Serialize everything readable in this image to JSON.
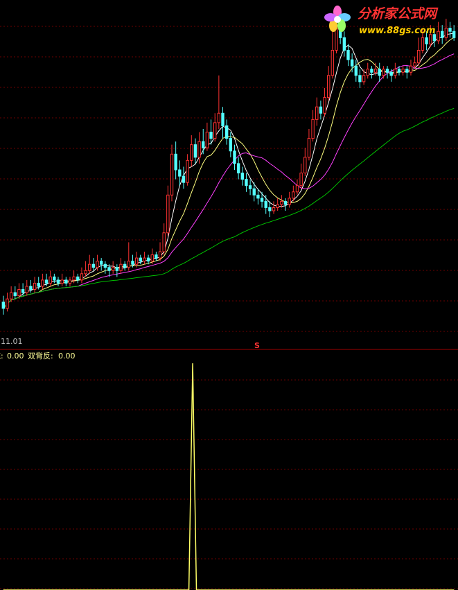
{
  "colors": {
    "background": "#000000",
    "grid": "#6b0000",
    "separator": "#a00000",
    "candle_up": "#ff3232",
    "candle_down": "#54ffff",
    "ma_short": "#ffffff",
    "ma_mid": "#ffff80",
    "ma_long": "#ff40ff",
    "ma_longest": "#00c000",
    "indicator_line": "#ffff66",
    "date_text": "#c0c0c0",
    "indicator_text": "#ffff99",
    "logo_text": "#ff3333",
    "url_text": "#ffcc00"
  },
  "header": {
    "date_label": "11.01",
    "marker": "S",
    "indicator_prefix": "底:",
    "indicator_prefix_value": "0.00",
    "indicator_name": "双背反:",
    "indicator_value": "0.00"
  },
  "logo": {
    "title": "分析家公式网",
    "url": "www.88gs.com",
    "icon": "flower-icon"
  },
  "chart_data": [
    {
      "type": "candlestick",
      "title": "",
      "xlabel": "",
      "ylabel": "",
      "grid": true,
      "ylim": [
        0,
        100
      ],
      "candles": [
        {
          "o": 8,
          "c": 6,
          "h": 10,
          "l": 4
        },
        {
          "o": 6,
          "c": 9,
          "h": 11,
          "l": 5
        },
        {
          "o": 9,
          "c": 11,
          "h": 13,
          "l": 8
        },
        {
          "o": 11,
          "c": 10,
          "h": 13,
          "l": 9
        },
        {
          "o": 10,
          "c": 12,
          "h": 14,
          "l": 9
        },
        {
          "o": 12,
          "c": 11,
          "h": 14,
          "l": 10
        },
        {
          "o": 11,
          "c": 13,
          "h": 15,
          "l": 10
        },
        {
          "o": 13,
          "c": 12,
          "h": 15,
          "l": 11
        },
        {
          "o": 12,
          "c": 14,
          "h": 16,
          "l": 11
        },
        {
          "o": 14,
          "c": 13,
          "h": 16,
          "l": 12
        },
        {
          "o": 13,
          "c": 15,
          "h": 17,
          "l": 12
        },
        {
          "o": 15,
          "c": 14,
          "h": 17,
          "l": 13
        },
        {
          "o": 14,
          "c": 16,
          "h": 18,
          "l": 13
        },
        {
          "o": 16,
          "c": 15,
          "h": 17,
          "l": 14
        },
        {
          "o": 15,
          "c": 14,
          "h": 16,
          "l": 13
        },
        {
          "o": 14,
          "c": 15,
          "h": 17,
          "l": 13
        },
        {
          "o": 15,
          "c": 14,
          "h": 16,
          "l": 13
        },
        {
          "o": 14,
          "c": 15,
          "h": 16,
          "l": 13
        },
        {
          "o": 15,
          "c": 16,
          "h": 18,
          "l": 14
        },
        {
          "o": 16,
          "c": 15,
          "h": 17,
          "l": 14
        },
        {
          "o": 15,
          "c": 17,
          "h": 19,
          "l": 14
        },
        {
          "o": 17,
          "c": 18,
          "h": 21,
          "l": 16
        },
        {
          "o": 18,
          "c": 20,
          "h": 23,
          "l": 17
        },
        {
          "o": 20,
          "c": 19,
          "h": 22,
          "l": 18
        },
        {
          "o": 19,
          "c": 21,
          "h": 23,
          "l": 18
        },
        {
          "o": 21,
          "c": 20,
          "h": 22,
          "l": 18
        },
        {
          "o": 20,
          "c": 19,
          "h": 21,
          "l": 17
        },
        {
          "o": 19,
          "c": 18,
          "h": 20,
          "l": 16
        },
        {
          "o": 18,
          "c": 19,
          "h": 21,
          "l": 17
        },
        {
          "o": 19,
          "c": 18,
          "h": 20,
          "l": 16
        },
        {
          "o": 18,
          "c": 20,
          "h": 22,
          "l": 17
        },
        {
          "o": 20,
          "c": 19,
          "h": 21,
          "l": 18
        },
        {
          "o": 19,
          "c": 21,
          "h": 27,
          "l": 18
        },
        {
          "o": 21,
          "c": 20,
          "h": 23,
          "l": 19
        },
        {
          "o": 20,
          "c": 22,
          "h": 24,
          "l": 19
        },
        {
          "o": 22,
          "c": 21,
          "h": 23,
          "l": 20
        },
        {
          "o": 21,
          "c": 22,
          "h": 24,
          "l": 20
        },
        {
          "o": 22,
          "c": 21,
          "h": 23,
          "l": 20
        },
        {
          "o": 21,
          "c": 23,
          "h": 25,
          "l": 20
        },
        {
          "o": 23,
          "c": 22,
          "h": 24,
          "l": 21
        },
        {
          "o": 22,
          "c": 24,
          "h": 27,
          "l": 21
        },
        {
          "o": 24,
          "c": 30,
          "h": 33,
          "l": 23
        },
        {
          "o": 30,
          "c": 42,
          "h": 45,
          "l": 29
        },
        {
          "o": 42,
          "c": 55,
          "h": 58,
          "l": 40
        },
        {
          "o": 55,
          "c": 50,
          "h": 59,
          "l": 47
        },
        {
          "o": 50,
          "c": 48,
          "h": 53,
          "l": 45
        },
        {
          "o": 48,
          "c": 46,
          "h": 51,
          "l": 44
        },
        {
          "o": 46,
          "c": 53,
          "h": 55,
          "l": 45
        },
        {
          "o": 53,
          "c": 58,
          "h": 61,
          "l": 51
        },
        {
          "o": 58,
          "c": 54,
          "h": 60,
          "l": 52
        },
        {
          "o": 54,
          "c": 59,
          "h": 62,
          "l": 52
        },
        {
          "o": 59,
          "c": 57,
          "h": 63,
          "l": 55
        },
        {
          "o": 57,
          "c": 62,
          "h": 65,
          "l": 56
        },
        {
          "o": 62,
          "c": 60,
          "h": 66,
          "l": 58
        },
        {
          "o": 60,
          "c": 65,
          "h": 68,
          "l": 59
        },
        {
          "o": 65,
          "c": 68,
          "h": 80,
          "l": 63
        },
        {
          "o": 68,
          "c": 64,
          "h": 70,
          "l": 60
        },
        {
          "o": 64,
          "c": 60,
          "h": 66,
          "l": 58
        },
        {
          "o": 60,
          "c": 56,
          "h": 62,
          "l": 54
        },
        {
          "o": 56,
          "c": 52,
          "h": 58,
          "l": 50
        },
        {
          "o": 52,
          "c": 49,
          "h": 54,
          "l": 47
        },
        {
          "o": 49,
          "c": 47,
          "h": 51,
          "l": 45
        },
        {
          "o": 47,
          "c": 45,
          "h": 49,
          "l": 43
        },
        {
          "o": 45,
          "c": 44,
          "h": 47,
          "l": 42
        },
        {
          "o": 44,
          "c": 42,
          "h": 46,
          "l": 40
        },
        {
          "o": 42,
          "c": 41,
          "h": 44,
          "l": 39
        },
        {
          "o": 41,
          "c": 40,
          "h": 43,
          "l": 38
        },
        {
          "o": 40,
          "c": 38,
          "h": 42,
          "l": 36
        },
        {
          "o": 38,
          "c": 37,
          "h": 40,
          "l": 35
        },
        {
          "o": 37,
          "c": 38,
          "h": 40,
          "l": 36
        },
        {
          "o": 38,
          "c": 39,
          "h": 41,
          "l": 37
        },
        {
          "o": 39,
          "c": 40,
          "h": 42,
          "l": 38
        },
        {
          "o": 40,
          "c": 39,
          "h": 41,
          "l": 37
        },
        {
          "o": 39,
          "c": 41,
          "h": 43,
          "l": 38
        },
        {
          "o": 41,
          "c": 43,
          "h": 45,
          "l": 40
        },
        {
          "o": 43,
          "c": 45,
          "h": 47,
          "l": 42
        },
        {
          "o": 45,
          "c": 49,
          "h": 52,
          "l": 44
        },
        {
          "o": 49,
          "c": 54,
          "h": 57,
          "l": 48
        },
        {
          "o": 54,
          "c": 60,
          "h": 63,
          "l": 53
        },
        {
          "o": 60,
          "c": 66,
          "h": 69,
          "l": 59
        },
        {
          "o": 66,
          "c": 70,
          "h": 73,
          "l": 64
        },
        {
          "o": 70,
          "c": 68,
          "h": 72,
          "l": 66
        },
        {
          "o": 68,
          "c": 73,
          "h": 76,
          "l": 67
        },
        {
          "o": 73,
          "c": 80,
          "h": 83,
          "l": 72
        },
        {
          "o": 80,
          "c": 88,
          "h": 96,
          "l": 79
        },
        {
          "o": 88,
          "c": 95,
          "h": 99,
          "l": 87
        },
        {
          "o": 95,
          "c": 92,
          "h": 99,
          "l": 90
        },
        {
          "o": 92,
          "c": 88,
          "h": 94,
          "l": 86
        },
        {
          "o": 88,
          "c": 85,
          "h": 90,
          "l": 83
        },
        {
          "o": 85,
          "c": 83,
          "h": 87,
          "l": 81
        },
        {
          "o": 83,
          "c": 80,
          "h": 85,
          "l": 78
        },
        {
          "o": 80,
          "c": 78,
          "h": 82,
          "l": 76
        },
        {
          "o": 78,
          "c": 80,
          "h": 82,
          "l": 77
        },
        {
          "o": 80,
          "c": 82,
          "h": 84,
          "l": 79
        },
        {
          "o": 82,
          "c": 81,
          "h": 83,
          "l": 79
        },
        {
          "o": 81,
          "c": 82,
          "h": 84,
          "l": 80
        },
        {
          "o": 82,
          "c": 80,
          "h": 84,
          "l": 78
        },
        {
          "o": 80,
          "c": 82,
          "h": 83,
          "l": 79
        },
        {
          "o": 82,
          "c": 81,
          "h": 83,
          "l": 79
        },
        {
          "o": 81,
          "c": 80,
          "h": 82,
          "l": 78
        },
        {
          "o": 80,
          "c": 82,
          "h": 84,
          "l": 79
        },
        {
          "o": 82,
          "c": 81,
          "h": 83,
          "l": 80
        },
        {
          "o": 81,
          "c": 82,
          "h": 83,
          "l": 80
        },
        {
          "o": 82,
          "c": 81,
          "h": 83,
          "l": 79
        },
        {
          "o": 81,
          "c": 83,
          "h": 85,
          "l": 80
        },
        {
          "o": 83,
          "c": 84,
          "h": 86,
          "l": 82
        },
        {
          "o": 84,
          "c": 88,
          "h": 92,
          "l": 83
        },
        {
          "o": 88,
          "c": 92,
          "h": 95,
          "l": 87
        },
        {
          "o": 92,
          "c": 90,
          "h": 94,
          "l": 88
        },
        {
          "o": 90,
          "c": 93,
          "h": 96,
          "l": 89
        },
        {
          "o": 93,
          "c": 91,
          "h": 95,
          "l": 89
        },
        {
          "o": 91,
          "c": 94,
          "h": 97,
          "l": 90
        },
        {
          "o": 94,
          "c": 92,
          "h": 96,
          "l": 90
        },
        {
          "o": 92,
          "c": 95,
          "h": 98,
          "l": 91
        },
        {
          "o": 95,
          "c": 94,
          "h": 97,
          "l": 92
        },
        {
          "o": 94,
          "c": 92,
          "h": 96,
          "l": 91
        }
      ]
    },
    {
      "type": "line",
      "title": "",
      "xlabel": "",
      "ylabel": "",
      "grid": true,
      "ylim": [
        0,
        1
      ],
      "series": [
        {
          "values": [
            0,
            0,
            0,
            0,
            0,
            0,
            0,
            0,
            0,
            0,
            0,
            0,
            0,
            0,
            0,
            0,
            0,
            0,
            0,
            0,
            0,
            0,
            0,
            0,
            0,
            0,
            0,
            0,
            0,
            0,
            0,
            0,
            0,
            0,
            0,
            0,
            0,
            0,
            0,
            0,
            0,
            0,
            0,
            0,
            0,
            0,
            0,
            0,
            0,
            0,
            1,
            0,
            0,
            0,
            0,
            0,
            0,
            0,
            0,
            0,
            0,
            0,
            0,
            0,
            0,
            0,
            0,
            0,
            0,
            0,
            0,
            0,
            0,
            0,
            0,
            0,
            0,
            0,
            0,
            0,
            0,
            0,
            0,
            0,
            0,
            0,
            0,
            0,
            0,
            0,
            0,
            0,
            0,
            0,
            0,
            0,
            0,
            0,
            0,
            0,
            0,
            0,
            0,
            0,
            0,
            0,
            0,
            0,
            0,
            0,
            0,
            0,
            0,
            0,
            0,
            0,
            0,
            0,
            0,
            0
          ]
        }
      ]
    }
  ]
}
